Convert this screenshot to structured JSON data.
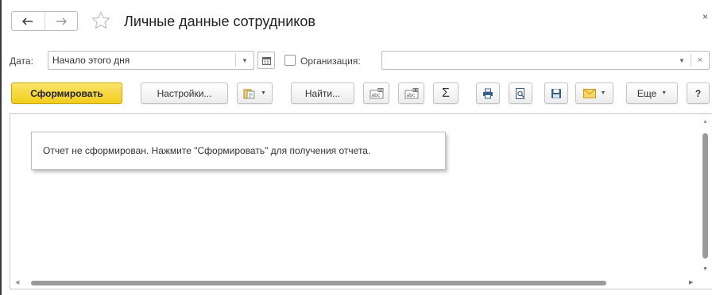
{
  "header": {
    "title": "Личные данные сотрудников",
    "back_icon": "arrow-left-icon",
    "forward_icon": "arrow-right-icon",
    "favorite_icon": "star-icon",
    "close_label": "×"
  },
  "filters": {
    "date_label": "Дата:",
    "date_value": "Начало этого дня",
    "org_label": "Организация:",
    "org_value": "",
    "org_checked": false,
    "org_clear": "×"
  },
  "toolbar": {
    "generate_label": "Сформировать",
    "settings_label": "Настройки...",
    "find_label": "Найти...",
    "more_label": "Еще",
    "help_label": "?",
    "sum_label": "Σ",
    "accent_color": "#f2cd1c"
  },
  "report": {
    "message": "Отчет не сформирован. Нажмите \"Сформировать\" для получения отчета."
  }
}
